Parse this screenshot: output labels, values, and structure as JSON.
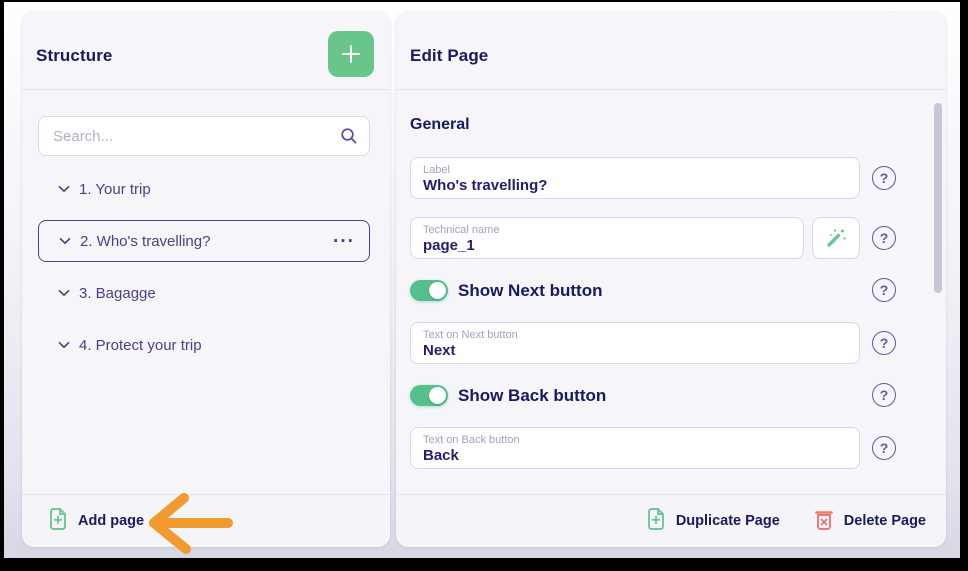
{
  "colors": {
    "accent_green": "#68c68b",
    "toggle_on_green": "#55c08c",
    "heading_navy": "#1a1a60",
    "item_purple": "#454287",
    "help_purple": "#5f58a8",
    "delete_red": "#f4776f",
    "annotation_orange": "#f09a30"
  },
  "left_panel": {
    "title": "Structure",
    "search_placeholder": "Search...",
    "pages": [
      {
        "label": "1. Your trip",
        "selected": false
      },
      {
        "label": "2. Who's travelling?",
        "selected": true
      },
      {
        "label": "3. Bagagge",
        "selected": false
      },
      {
        "label": "4. Protect your trip",
        "selected": false
      }
    ],
    "selected_page_menu_glyph": "···",
    "add_page_label": "Add page"
  },
  "right_panel": {
    "title": "Edit Page",
    "section": "General",
    "label_field": {
      "label": "Label",
      "value": "Who's travelling?"
    },
    "technical_field": {
      "label": "Technical name",
      "value": "page_1"
    },
    "show_next_toggle": {
      "label": "Show Next button",
      "state": "on"
    },
    "next_field": {
      "label": "Text on Next button",
      "value": "Next"
    },
    "show_back_toggle": {
      "label": "Show Back button",
      "state": "on"
    },
    "back_field": {
      "label": "Text on Back button",
      "value": "Back"
    },
    "duplicate_label": "Duplicate Page",
    "delete_label": "Delete Page"
  },
  "icons": {
    "help_glyph": "?"
  }
}
